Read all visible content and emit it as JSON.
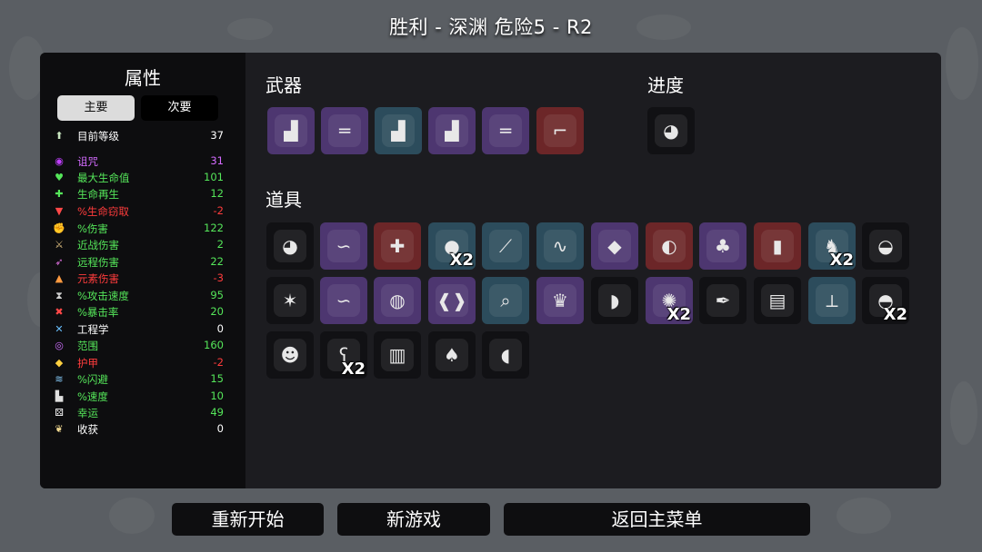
{
  "title": "胜利 - 深渊    危险5 - R2",
  "stats": {
    "title": "属性",
    "tabs": {
      "primary": "主要",
      "secondary": "次要"
    },
    "rows": [
      {
        "label": "目前等级",
        "value": "37",
        "color": "#ffffff",
        "icon": "level-up-icon"
      },
      {
        "label": "诅咒",
        "value": "31",
        "color": "#d46bff",
        "icon": "curse-eye-icon"
      },
      {
        "label": "最大生命值",
        "value": "101",
        "color": "#55e65a",
        "icon": "heart-icon"
      },
      {
        "label": "生命再生",
        "value": "12",
        "color": "#55e65a",
        "icon": "heart-plus-icon"
      },
      {
        "label": "%生命窃取",
        "value": "-2",
        "color": "#ff3c3c",
        "icon": "fang-icon"
      },
      {
        "label": "%伤害",
        "value": "122",
        "color": "#55e65a",
        "icon": "muscle-icon"
      },
      {
        "label": "近战伤害",
        "value": "2",
        "color": "#55e65a",
        "icon": "sword-icon"
      },
      {
        "label": "远程伤害",
        "value": "22",
        "color": "#55e65a",
        "icon": "bow-icon"
      },
      {
        "label": "元素伤害",
        "value": "-3",
        "color": "#ff3c3c",
        "icon": "flame-icon"
      },
      {
        "label": "%攻击速度",
        "value": "95",
        "color": "#55e65a",
        "icon": "hourglass-icon"
      },
      {
        "label": "%暴击率",
        "value": "20",
        "color": "#55e65a",
        "icon": "crit-icon"
      },
      {
        "label": "工程学",
        "value": "0",
        "color": "#ffffff",
        "icon": "wrench-icon"
      },
      {
        "label": "范围",
        "value": "160",
        "color": "#55e65a",
        "icon": "range-icon"
      },
      {
        "label": "护甲",
        "value": "-2",
        "color": "#ff3c3c",
        "icon": "shield-icon"
      },
      {
        "label": "%闪避",
        "value": "15",
        "color": "#55e65a",
        "icon": "dodge-icon"
      },
      {
        "label": "%速度",
        "value": "10",
        "color": "#55e65a",
        "icon": "boot-icon"
      },
      {
        "label": "幸运",
        "value": "49",
        "color": "#55e65a",
        "icon": "dice-icon"
      },
      {
        "label": "收获",
        "value": "0",
        "color": "#ffffff",
        "icon": "wheat-icon"
      }
    ]
  },
  "weapons": {
    "title": "武器",
    "items": [
      {
        "icon": "smg-icon",
        "tier": "purple"
      },
      {
        "icon": "double-barrel-shotgun-icon",
        "tier": "purple"
      },
      {
        "icon": "smg-icon",
        "tier": "blue"
      },
      {
        "icon": "smg-icon",
        "tier": "purple"
      },
      {
        "icon": "double-barrel-shotgun-icon",
        "tier": "purple"
      },
      {
        "icon": "laser-gun-icon",
        "tier": "red"
      }
    ]
  },
  "progress": {
    "title": "进度",
    "items": [
      {
        "icon": "egg-character-icon",
        "tier": "black"
      }
    ]
  },
  "items": {
    "title": "道具",
    "list": [
      {
        "icon": "bloody-egg-icon",
        "tier": "black",
        "qty": ""
      },
      {
        "icon": "scarf-icon",
        "tier": "purple",
        "qty": ""
      },
      {
        "icon": "medkit-icon",
        "tier": "red",
        "qty": ""
      },
      {
        "icon": "dark-blob-icon",
        "tier": "blue",
        "qty": "X2"
      },
      {
        "icon": "bone-skewer-icon",
        "tier": "blue",
        "qty": ""
      },
      {
        "icon": "worm-icon",
        "tier": "blue",
        "qty": ""
      },
      {
        "icon": "crystal-icon",
        "tier": "purple",
        "qty": ""
      },
      {
        "icon": "stomach-icon",
        "tier": "red",
        "qty": ""
      },
      {
        "icon": "clover-icon",
        "tier": "purple",
        "qty": ""
      },
      {
        "icon": "blood-vial-icon",
        "tier": "red",
        "qty": ""
      },
      {
        "icon": "rabbit-icon",
        "tier": "blue",
        "qty": "X2"
      },
      {
        "icon": "bandaged-head-icon",
        "tier": "black",
        "qty": ""
      },
      {
        "icon": "hedgehog-icon",
        "tier": "black",
        "qty": ""
      },
      {
        "icon": "scarf-icon",
        "tier": "purple",
        "qty": ""
      },
      {
        "icon": "tardigrade-icon",
        "tier": "purple",
        "qty": ""
      },
      {
        "icon": "wings-icon",
        "tier": "purple",
        "qty": ""
      },
      {
        "icon": "spyglass-icon",
        "tier": "blue",
        "qty": ""
      },
      {
        "icon": "crown-icon",
        "tier": "purple",
        "qty": ""
      },
      {
        "icon": "whistle-icon",
        "tier": "black",
        "qty": ""
      },
      {
        "icon": "peacock-icon",
        "tier": "purple",
        "qty": "X2"
      },
      {
        "icon": "feather-pen-icon",
        "tier": "black",
        "qty": ""
      },
      {
        "icon": "banknote-icon",
        "tier": "black",
        "qty": ""
      },
      {
        "icon": "metal-detector-icon",
        "tier": "blue",
        "qty": ""
      },
      {
        "icon": "helmet-creature-icon",
        "tier": "black",
        "qty": "X2"
      },
      {
        "icon": "ghost-mask-icon",
        "tier": "black",
        "qty": ""
      },
      {
        "icon": "teddy-bear-icon",
        "tier": "black",
        "qty": "X2"
      },
      {
        "icon": "dynamite-icon",
        "tier": "black",
        "qty": ""
      },
      {
        "icon": "tree-icon",
        "tier": "black",
        "qty": ""
      },
      {
        "icon": "rubber-duck-icon",
        "tier": "black",
        "qty": ""
      }
    ]
  },
  "buttons": {
    "restart": "重新开始",
    "new_game": "新游戏",
    "main_menu": "返回主菜单"
  }
}
